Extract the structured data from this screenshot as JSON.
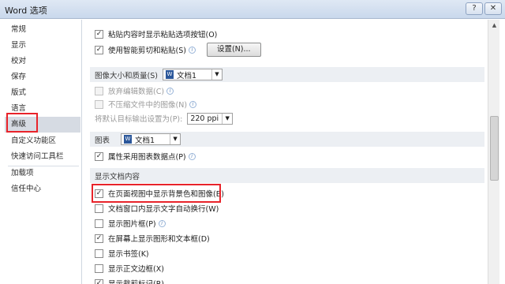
{
  "window": {
    "title": "Word 选项",
    "help": "?",
    "close": "✕"
  },
  "sidebar": {
    "items": [
      {
        "label": "常规"
      },
      {
        "label": "显示"
      },
      {
        "label": "校对"
      },
      {
        "label": "保存"
      },
      {
        "label": "版式"
      },
      {
        "label": "语言"
      },
      {
        "label": "高级",
        "active": true
      },
      {
        "label": "自定义功能区"
      },
      {
        "label": "快速访问工具栏"
      },
      {
        "label": "加载项"
      },
      {
        "label": "信任中心"
      }
    ]
  },
  "clipboard": {
    "show_paste_options": {
      "label": "粘贴内容时显示粘贴选项按钮(O)",
      "checked": true
    },
    "smart_cut_paste": {
      "label": "使用智能剪切和粘贴(S)",
      "checked": true
    },
    "settings_button": "设置(N)..."
  },
  "image_quality": {
    "header": "图像大小和质量(S)",
    "document": "文档1",
    "discard_edit_data": {
      "label": "放弃编辑数据(C)",
      "checked": false
    },
    "no_compress": {
      "label": "不压缩文件中的图像(N)",
      "checked": false
    },
    "default_output_label": "将默认目标输出设置为(P):",
    "default_output_value": "220 ppi"
  },
  "chart": {
    "header": "图表",
    "document": "文档1",
    "properties_follow": {
      "label": "属性采用图表数据点(P)",
      "checked": true
    }
  },
  "display_content": {
    "header": "显示文档内容",
    "items": [
      {
        "label": "在页面视图中显示背景色和图像(B)",
        "checked": true
      },
      {
        "label": "文档窗口内显示文字自动换行(W)",
        "checked": false
      },
      {
        "label": "显示图片框(P)",
        "checked": false
      },
      {
        "label": "在屏幕上显示图形和文本框(D)",
        "checked": true
      },
      {
        "label": "显示书签(K)",
        "checked": false
      },
      {
        "label": "显示正文边框(X)",
        "checked": false
      },
      {
        "label": "显示裁剪标记(R)",
        "checked": true
      }
    ]
  },
  "glyphs": {
    "check": "✓",
    "info": "i",
    "dropdown": "▼",
    "scroll_up": "▲"
  },
  "colors": {
    "highlight": "#e8232a",
    "active_sidebar": "#d6dbe3",
    "section_bg": "#eceff3"
  }
}
